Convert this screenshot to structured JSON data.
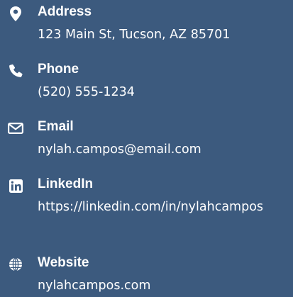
{
  "contact": {
    "address": {
      "label": "Address",
      "value": "123 Main St, Tucson, AZ 85701",
      "icon": "map-marker-icon"
    },
    "phone": {
      "label": "Phone",
      "value": "(520) 555-1234",
      "icon": "phone-icon"
    },
    "email": {
      "label": "Email",
      "value": "nylah.campos@email.com",
      "icon": "envelope-icon"
    },
    "linkedin": {
      "label": "LinkedIn",
      "value": "https://linkedin.com/in/nylahcampos",
      "icon": "linkedin-icon"
    },
    "website": {
      "label": "Website",
      "value": "nylahcampos.com",
      "icon": "globe-icon"
    }
  },
  "colors": {
    "background": "#3c5a7e",
    "text": "#ffffff"
  }
}
